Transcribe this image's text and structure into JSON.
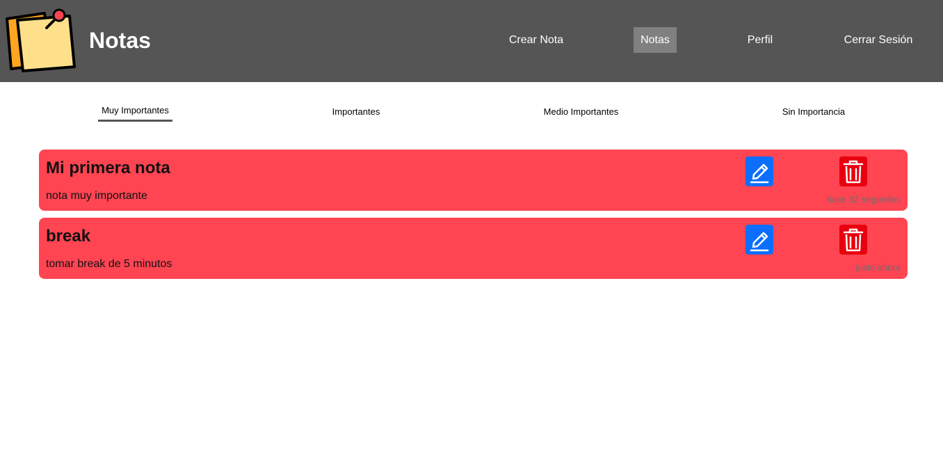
{
  "header": {
    "brand": "Notas",
    "nav": [
      {
        "label": "Crear Nota"
      },
      {
        "label": "Notas"
      },
      {
        "label": "Perfil"
      },
      {
        "label": "Cerrar Sesión"
      }
    ],
    "active_nav": "Notas",
    "background": "#555555",
    "active_background": "#808080"
  },
  "tabs": [
    {
      "label": "Muy Importantes"
    },
    {
      "label": "Importantes"
    },
    {
      "label": "Medio Importantes"
    },
    {
      "label": "Sin Importancia"
    }
  ],
  "active_tab": "Muy Importantes",
  "notes": [
    {
      "title": "Mi primera nota",
      "body": "nota muy importante",
      "time": "hace 32 segundos"
    },
    {
      "title": "break",
      "body": "tomar break de 5 minutos",
      "time": "justo ahora"
    }
  ],
  "icons": {
    "logo": "sticky-notes-pin-icon",
    "edit": "pencil-square-icon",
    "delete": "trash-icon"
  },
  "colors": {
    "note_background": "#ff4452",
    "edit_button": "#0d6efd",
    "delete_button": "#e8000e"
  }
}
